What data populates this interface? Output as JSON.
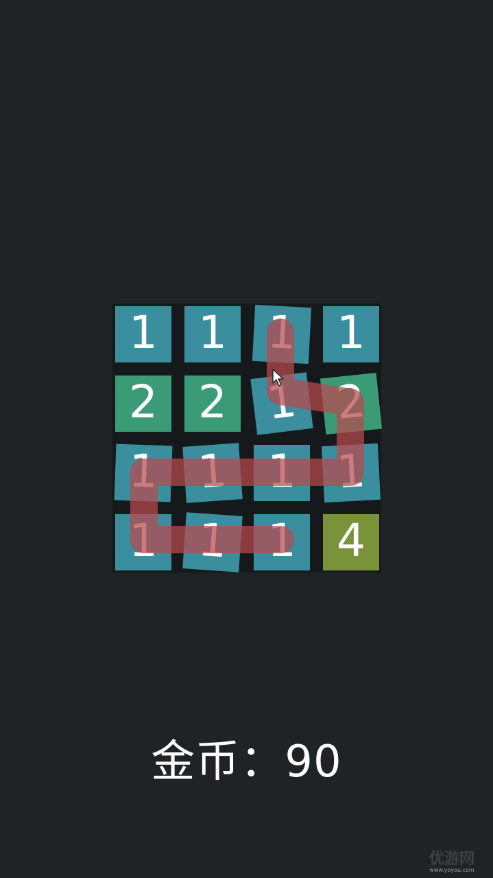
{
  "board": {
    "rows": [
      [
        {
          "value": "1",
          "color": "#3a8e9e",
          "tilt": 0
        },
        {
          "value": "1",
          "color": "#3a8e9e",
          "tilt": 0
        },
        {
          "value": "1",
          "color": "#3a8e9e",
          "tilt": 3
        },
        {
          "value": "1",
          "color": "#3a8e9e",
          "tilt": 0
        }
      ],
      [
        {
          "value": "2",
          "color": "#3c9b77",
          "tilt": 0
        },
        {
          "value": "2",
          "color": "#3c9b77",
          "tilt": 0
        },
        {
          "value": "1",
          "color": "#3a8e9e",
          "tilt": -7
        },
        {
          "value": "2",
          "color": "#3c9b77",
          "tilt": -6
        }
      ],
      [
        {
          "value": "1",
          "color": "#3a8e9e",
          "tilt": 2
        },
        {
          "value": "1",
          "color": "#3a8e9e",
          "tilt": -4
        },
        {
          "value": "1",
          "color": "#3a8e9e",
          "tilt": 0
        },
        {
          "value": "1",
          "color": "#3a8e9e",
          "tilt": -3
        }
      ],
      [
        {
          "value": "1",
          "color": "#3a8e9e",
          "tilt": 0
        },
        {
          "value": "1",
          "color": "#3a8e9e",
          "tilt": 4
        },
        {
          "value": "1",
          "color": "#3a8e9e",
          "tilt": 0
        },
        {
          "value": "4",
          "color": "#7a923a",
          "tilt": 0
        }
      ]
    ],
    "selected_path_color": "#b84a4e"
  },
  "status": {
    "coins_label": "金币：",
    "coins_value": "90"
  },
  "watermark": {
    "text": "优游网",
    "url": "www.yoyou.com"
  }
}
